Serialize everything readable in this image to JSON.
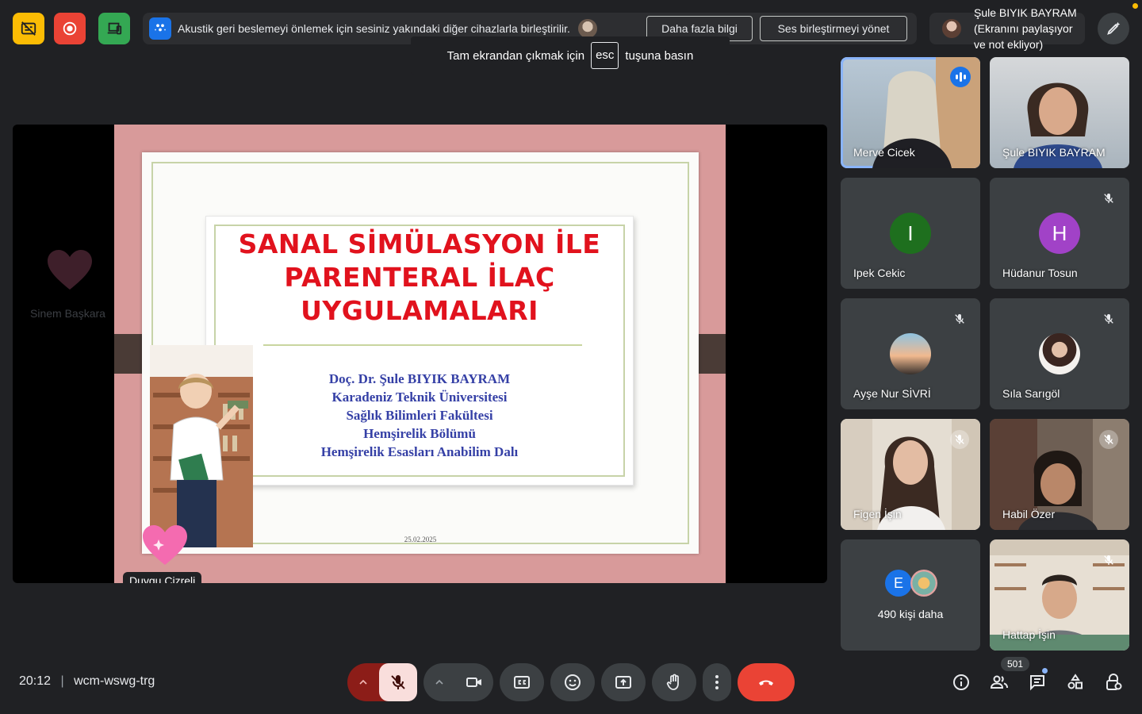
{
  "top": {
    "notice_text": "Akustik geri beslemeyi önlemek için sesiniz yakındaki diğer cihazlarla birleştirilir.",
    "more_info": "Daha fazla bilgi",
    "manage_audio": "Ses birleştirmeyi yönet",
    "presenter_text": "Şule BIYIK BAYRAM (Ekranını paylaşıyor ve not ekliyor)",
    "esc_before": "Tam ekrandan çıkmak için",
    "esc_key": "esc",
    "esc_after": "tuşuna basın"
  },
  "presentation": {
    "ghost_name": "Sinem Başkara",
    "title_lines": [
      "SANAL SİMÜLASYON İLE",
      "PARENTERAL İLAÇ",
      "UYGULAMALARI"
    ],
    "authors": [
      "Doç. Dr. Şule BIYIK BAYRAM",
      "Karadeniz Teknik Üniversitesi",
      "Sağlık Bilimleri Fakültesi",
      "Hemşirelik Bölümü",
      "Hemşirelik Esasları Anabilim Dalı"
    ],
    "date": "25.02.2025",
    "presenter_chip": "Duygu Cizreli"
  },
  "participants": [
    {
      "name": "Merve Cicek"
    },
    {
      "name": "Şule BIYIK BAYRAM"
    },
    {
      "name": "Ipek Cekic",
      "initial": "I",
      "color": "#1e6f1e"
    },
    {
      "name": "Hüdanur Tosun",
      "initial": "H",
      "color": "#a142c7"
    },
    {
      "name": "Ayşe Nur SİVRİ"
    },
    {
      "name": "Sıla Sarıgöl"
    },
    {
      "name": "Figen İşin"
    },
    {
      "name": "Habil Özer"
    },
    {
      "more_initial": "E",
      "more_text": "490 kişi daha"
    },
    {
      "name": "Hattap İşin"
    }
  ],
  "bottom": {
    "time": "20:12",
    "separator": "|",
    "meeting_code": "wcm-wswg-trg",
    "people_count": "501"
  },
  "colors": {
    "accent": "#8ab4f8",
    "hangup": "#ea4335",
    "slide_title": "#e1121d",
    "slide_authors": "#3540a6"
  }
}
